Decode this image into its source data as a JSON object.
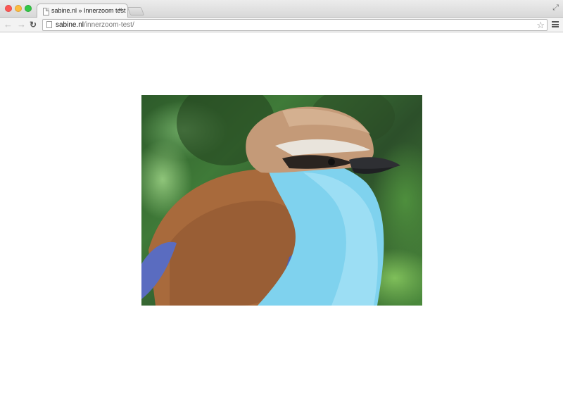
{
  "browser": {
    "tab": {
      "title": "sabine.nl » Innerzoom test",
      "close_glyph": "×"
    },
    "address": {
      "domain": "sabine.nl",
      "path": "/innerzoom-test/"
    },
    "icons": {
      "back": "back-arrow-icon",
      "forward": "forward-arrow-icon",
      "reload": "reload-icon",
      "bookmark": "star-icon",
      "menu": "hamburger-menu-icon",
      "fullscreen": "fullscreen-icon",
      "page": "page-icon"
    }
  },
  "page": {
    "image": {
      "subject": "racket-tailed roller bird photo",
      "colors": {
        "head": "#c49a78",
        "throat": "#7fd2ee",
        "body": "#a96a3a",
        "wing": "#5a6cc0",
        "foliage": "#3f7a38"
      }
    }
  }
}
